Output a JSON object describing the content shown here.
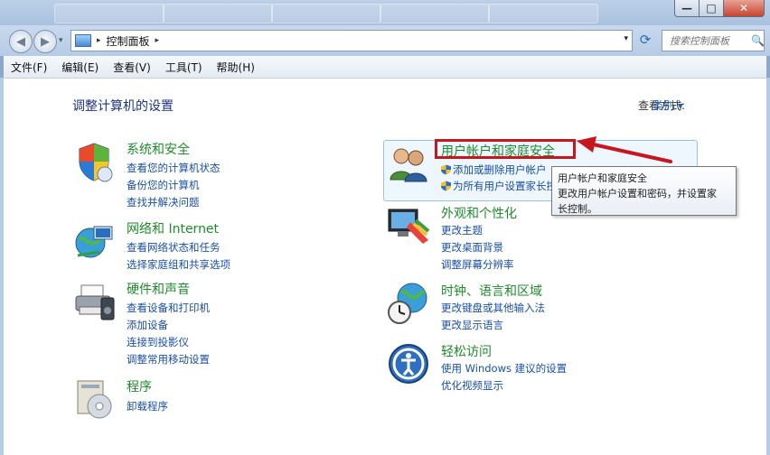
{
  "window": {
    "minimize_glyph": "—",
    "maximize_glyph": "□",
    "close_glyph": "✕"
  },
  "nav": {
    "back_icon": "back-arrow-icon",
    "forward_icon": "forward-arrow-icon",
    "history_glyph": "▾",
    "address_crumb": "控制面板",
    "crumb_separator": "▸",
    "dropdown_glyph": "▾",
    "refresh_glyph": "⟳",
    "search_placeholder": "搜索控制面板",
    "search_icon": "🔍"
  },
  "menu": [
    "文件(F)",
    "编辑(E)",
    "查看(V)",
    "工具(T)",
    "帮助(H)"
  ],
  "page": {
    "heading": "调整计算机的设置",
    "view_by_label": "查看方式:",
    "view_by_value": "类别 ▾"
  },
  "categories_left": [
    {
      "title": "系统和安全",
      "icon": "shield-icon",
      "links": [
        "查看您的计算机状态",
        "备份您的计算机",
        "查找并解决问题"
      ]
    },
    {
      "title": "网络和 Internet",
      "icon": "network-globe-icon",
      "links": [
        "查看网络状态和任务",
        "选择家庭组和共享选项"
      ]
    },
    {
      "title": "硬件和声音",
      "icon": "printer-icon",
      "links": [
        "查看设备和打印机",
        "添加设备",
        "连接到投影仪",
        "调整常用移动设置"
      ]
    },
    {
      "title": "程序",
      "icon": "programs-disc-icon",
      "links": [
        "卸载程序"
      ]
    }
  ],
  "categories_right": [
    {
      "title": "用户帐户和家庭安全",
      "icon": "users-icon",
      "links": [
        "添加或删除用户帐户",
        "为所有用户设置家长控制"
      ]
    },
    {
      "title": "外观和个性化",
      "icon": "monitor-palette-icon",
      "links": [
        "更改主题",
        "更改桌面背景",
        "调整屏幕分辨率"
      ]
    },
    {
      "title": "时钟、语言和区域",
      "icon": "clock-globe-icon",
      "links": [
        "更改键盘或其他输入法",
        "更改显示语言"
      ]
    },
    {
      "title": "轻松访问",
      "icon": "ease-of-access-icon",
      "links": [
        "使用 Windows 建议的设置",
        "优化视频显示"
      ]
    }
  ],
  "tooltip": {
    "line1": "用户帐户和家庭安全",
    "line2": "更改用户帐户设置和密码，并设置家",
    "line3": "长控制。"
  },
  "colors": {
    "category_title": "#1f8a2c",
    "link": "#1a4fa3",
    "annotation_red": "#c8161d"
  }
}
